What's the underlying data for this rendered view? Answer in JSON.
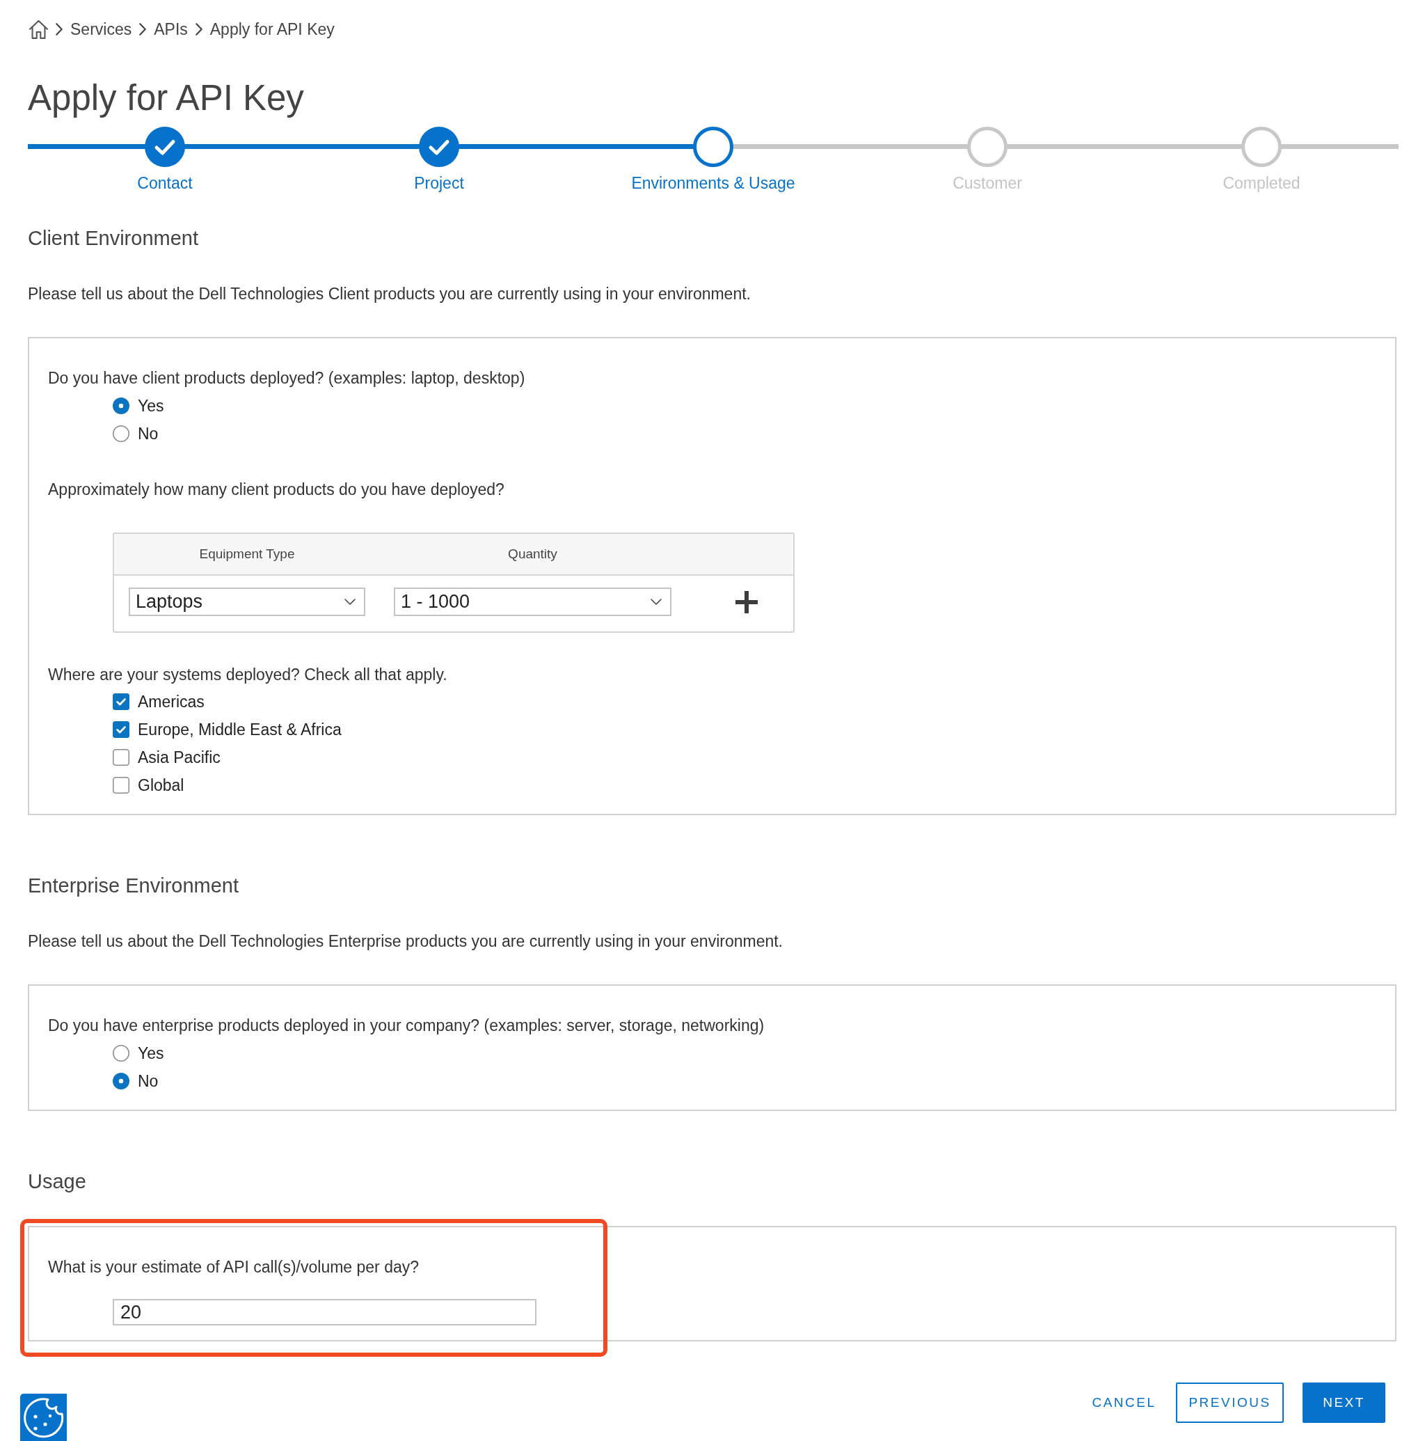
{
  "breadcrumb": [
    "Services",
    "APIs",
    "Apply for API Key"
  ],
  "title": "Apply for API Key",
  "steps": [
    {
      "label": "Contact",
      "completed": true,
      "selected": false
    },
    {
      "label": "Project",
      "completed": true,
      "selected": false
    },
    {
      "label": "Environments & Usage",
      "completed": false,
      "selected": true
    },
    {
      "label": "Customer",
      "completed": false,
      "selected": false
    },
    {
      "label": "Completed",
      "completed": false,
      "selected": false
    }
  ],
  "sections": [
    {
      "title": "Client Environment",
      "description": "Please tell us about the Dell Technologies Client products you are currently using in your environment.",
      "highlighted": false,
      "questions": [
        {
          "kind": "radio",
          "label": "Do you have client products deployed? (examples: laptop, desktop)",
          "options": [
            {
              "label": "Yes",
              "selected": true
            },
            {
              "label": "No",
              "selected": false
            }
          ]
        },
        {
          "kind": "table",
          "label": "Approximately how many client products do you have deployed?",
          "columns": [
            "Equipment Type",
            "Quantity"
          ],
          "rows": [
            {
              "cells": [
                "Laptops",
                "1 - 1000"
              ]
            }
          ]
        },
        {
          "kind": "checkbox",
          "label": "Where are your systems deployed? Check all that apply.",
          "options": [
            {
              "label": "Americas",
              "checked": true
            },
            {
              "label": "Europe, Middle East & Africa",
              "checked": true
            },
            {
              "label": "Asia Pacific",
              "checked": false
            },
            {
              "label": "Global",
              "checked": false
            }
          ]
        }
      ]
    },
    {
      "title": "Enterprise Environment",
      "description": "Please tell us about the Dell Technologies Enterprise products you are currently using in your environment.",
      "highlighted": false,
      "questions": [
        {
          "kind": "radio",
          "label": "Do you have enterprise products deployed in your company? (examples: server, storage, networking)",
          "options": [
            {
              "label": "Yes",
              "selected": false
            },
            {
              "label": "No",
              "selected": true
            }
          ]
        }
      ]
    },
    {
      "title": "Usage",
      "highlighted": true,
      "questions": [
        {
          "kind": "input",
          "label": "What is your estimate of API call(s)/volume per day?",
          "value": "20"
        }
      ]
    }
  ],
  "buttons": [
    {
      "label": "CANCEL",
      "kind": "text"
    },
    {
      "label": "PREVIOUS",
      "kind": "outline"
    },
    {
      "label": "NEXT",
      "kind": "primary"
    }
  ]
}
